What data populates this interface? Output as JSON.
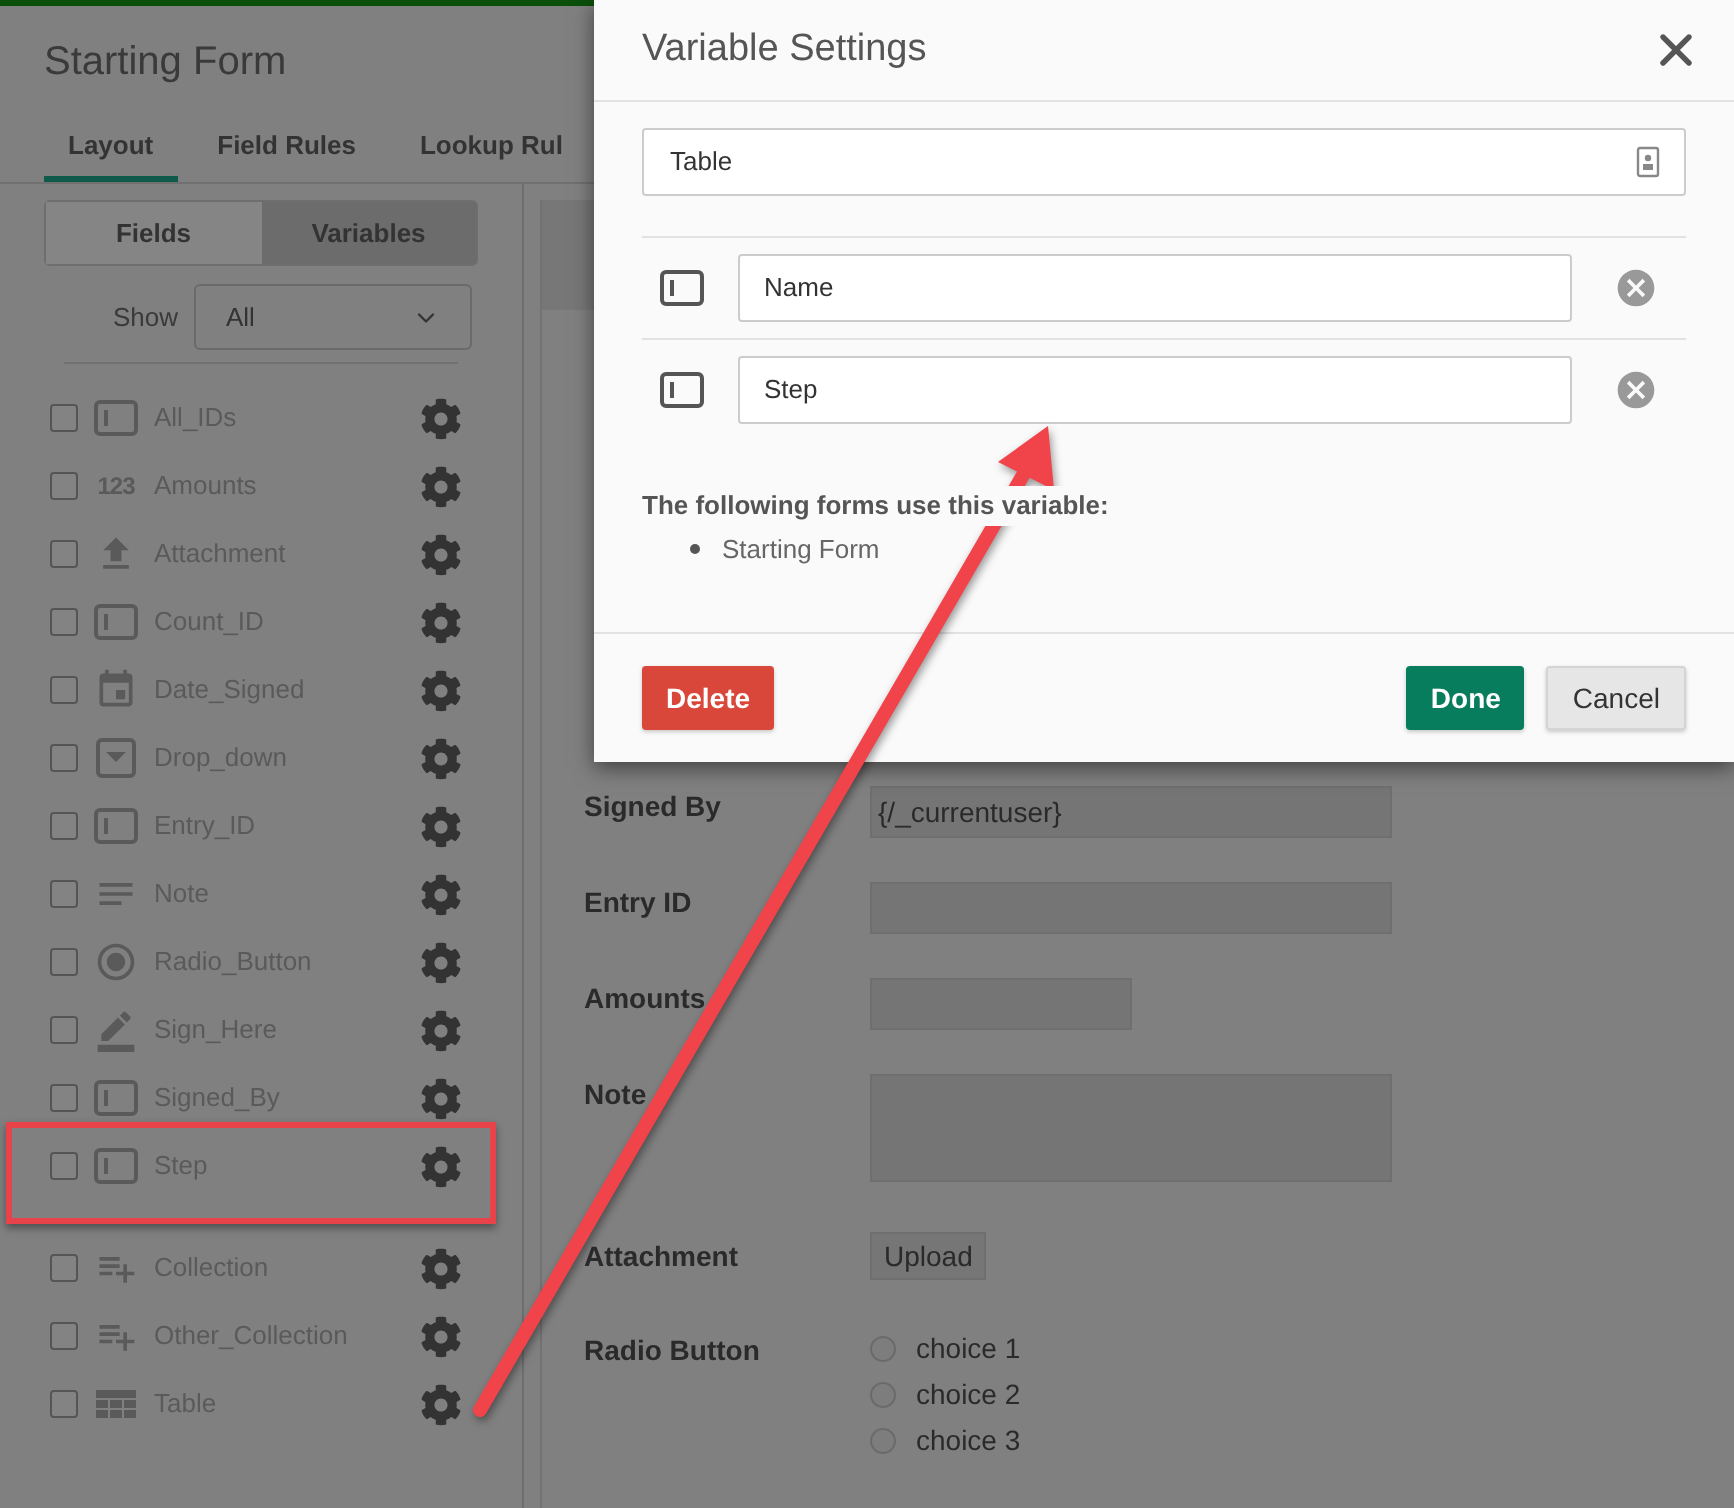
{
  "page": {
    "title": "Starting Form"
  },
  "tabs": [
    {
      "label": "Layout",
      "selected": true
    },
    {
      "label": "Field Rules",
      "selected": false
    },
    {
      "label": "Lookup Rul",
      "selected": false
    }
  ],
  "segments": [
    {
      "label": "Fields",
      "selected": false
    },
    {
      "label": "Variables",
      "selected": true
    }
  ],
  "show_filter": {
    "label": "Show",
    "value": "All"
  },
  "variables": [
    {
      "name": "All_IDs",
      "kind": "text",
      "checked": false,
      "highlighted": false
    },
    {
      "name": "Amounts",
      "kind": "number",
      "icon_text": "123",
      "checked": false,
      "highlighted": false
    },
    {
      "name": "Attachment",
      "kind": "upload",
      "checked": false,
      "highlighted": false
    },
    {
      "name": "Count_ID",
      "kind": "text",
      "checked": false,
      "highlighted": false
    },
    {
      "name": "Date_Signed",
      "kind": "date",
      "checked": false,
      "highlighted": false
    },
    {
      "name": "Drop_down",
      "kind": "dropdown",
      "checked": false,
      "highlighted": false
    },
    {
      "name": "Entry_ID",
      "kind": "text",
      "checked": false,
      "highlighted": false
    },
    {
      "name": "Note",
      "kind": "lines",
      "checked": false,
      "highlighted": false
    },
    {
      "name": "Radio_Button",
      "kind": "radio",
      "checked": false,
      "highlighted": false
    },
    {
      "name": "Sign_Here",
      "kind": "pen",
      "checked": false,
      "highlighted": false
    },
    {
      "name": "Signed_By",
      "kind": "text",
      "checked": false,
      "highlighted": false
    },
    {
      "name": "Step",
      "kind": "text",
      "checked": false,
      "highlighted": true
    }
  ],
  "collections": [
    {
      "name": "Collection",
      "kind": "collection",
      "checked": false
    },
    {
      "name": "Other_Collection",
      "kind": "collection",
      "checked": false
    },
    {
      "name": "Table",
      "kind": "table",
      "checked": false
    }
  ],
  "form": {
    "rows": [
      {
        "label": "Signed By",
        "kind": "text",
        "value": "{/_currentuser}"
      },
      {
        "label": "Entry ID",
        "kind": "text"
      },
      {
        "label": "Amounts",
        "kind": "short"
      },
      {
        "label": "Note",
        "kind": "textarea"
      },
      {
        "label": "Attachment",
        "kind": "upload",
        "button": "Upload"
      },
      {
        "label": "Radio Button",
        "kind": "radio",
        "options": [
          {
            "label": "choice 1",
            "selected": false
          },
          {
            "label": "choice 2",
            "selected": false
          },
          {
            "label": "choice 3",
            "selected": false
          }
        ]
      }
    ]
  },
  "dialog": {
    "title": "Variable Settings",
    "name_value": "Table",
    "columns": [
      {
        "value": "Name"
      },
      {
        "value": "Step"
      }
    ],
    "usage_text": "The following forms use this variable:",
    "usage_forms": [
      "Starting Form"
    ],
    "buttons": [
      {
        "label": "Delete",
        "kind": "danger"
      },
      {
        "label": "Done",
        "kind": "primary"
      },
      {
        "label": "Cancel",
        "kind": "default"
      }
    ]
  }
}
